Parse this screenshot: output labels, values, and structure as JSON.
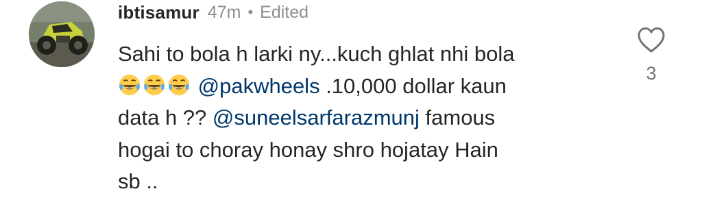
{
  "comment": {
    "username": "ibtisamur",
    "time": "47m",
    "separator": "•",
    "edited": "Edited",
    "lines": {
      "line1": "Sahi to bola h larki ny...kuch ghlat nhi bola",
      "line2_mention": "@pakwheels",
      "line2_text": " .10,000 dollar kaun",
      "line3_text": "data h ?? ",
      "line3_mention": "@suneelsarfarazmunj",
      "line3_tail": " famous",
      "line4": "hogai to choray honay shro hojatay Hain",
      "line5": "sb .."
    },
    "emojis": [
      "laughing-tears-emoji",
      "laughing-tears-emoji",
      "laughing-tears-emoji"
    ],
    "like_count": "3",
    "icons": {
      "like": "heart-outline-icon"
    },
    "colors": {
      "text": "#262626",
      "meta": "#8e8e8e",
      "mention": "#00376b"
    }
  }
}
